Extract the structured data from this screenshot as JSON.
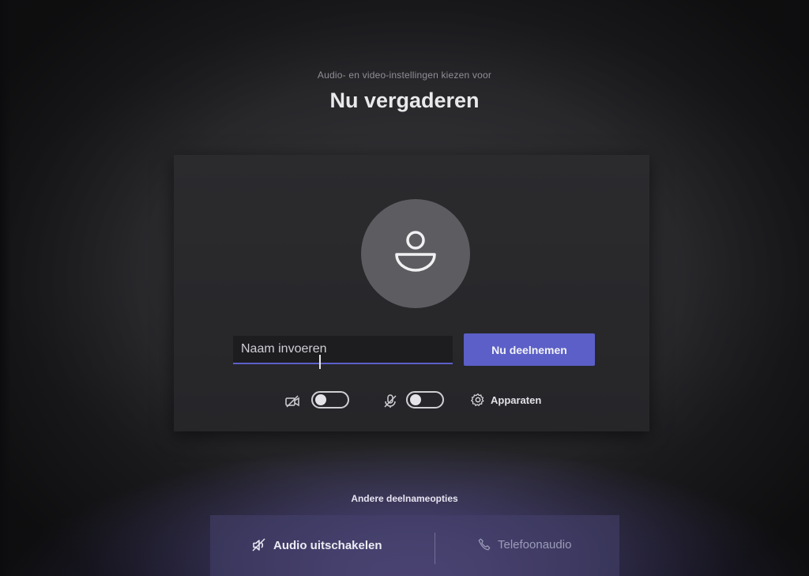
{
  "header": {
    "subtitle": "Audio- en video-instellingen kiezen voor",
    "title": "Nu vergaderen"
  },
  "join": {
    "name_placeholder": "Naam invoeren",
    "name_value": "",
    "join_label": "Nu deelnemen"
  },
  "controls": {
    "camera_toggle_on": false,
    "mic_toggle_on": false,
    "devices_label": "Apparaten"
  },
  "other_options": {
    "heading": "Andere deelnameopties",
    "audio_off_label": "Audio uitschakelen",
    "phone_audio_label": "Telefoonaudio"
  },
  "colors": {
    "accent": "#5b5fc7",
    "panel": "#2b2b2e",
    "avatar": "#5d5d61"
  }
}
